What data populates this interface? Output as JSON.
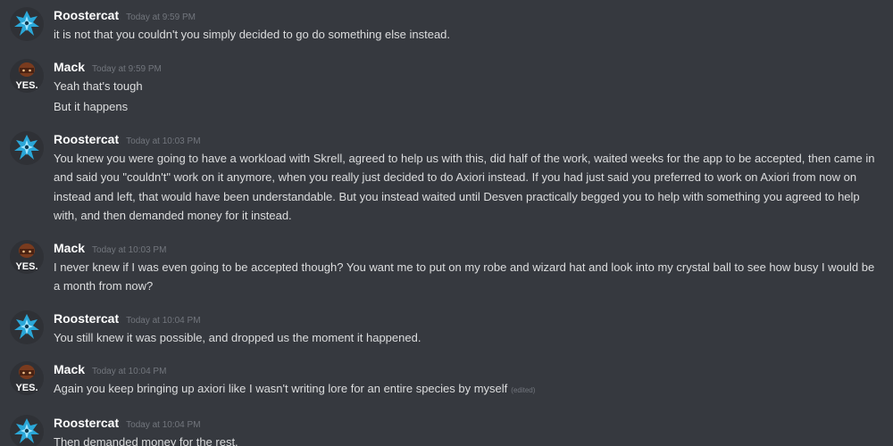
{
  "colors": {
    "background": "#36393f",
    "username": "#ffffff",
    "message_text": "#dcddde",
    "timestamp": "#72767d"
  },
  "avatars": {
    "roostercat": {
      "icon": "roostercat-avatar-icon",
      "color": "#2aa7d8"
    },
    "mack": {
      "icon": "mack-avatar-icon",
      "color": "#7a3b1e",
      "text": "YES."
    }
  },
  "groups": [
    {
      "username": "Roostercat",
      "timestamp": "Today at 9:59 PM",
      "messages": [
        "it is not that you couldn't you simply decided to go do something else instead."
      ]
    },
    {
      "username": "Mack",
      "timestamp": "Today at 9:59 PM",
      "messages": [
        "Yeah that's tough",
        "But it happens"
      ]
    },
    {
      "username": "Roostercat",
      "timestamp": "Today at 10:03 PM",
      "messages": [
        "You knew you were going to have a workload with Skrell, agreed to help us with this, did half of the work, waited weeks for the app to be accepted, then came in and said you \"couldn't\" work on it anymore, when you really just decided to do Axiori instead. If you had just said you preferred to work on Axiori from now on instead and left, that would have been understandable. But you instead waited until Desven practically begged you to help with something you agreed to help with, and then demanded money for it instead."
      ]
    },
    {
      "username": "Mack",
      "timestamp": "Today at 10:03 PM",
      "messages": [
        "I never knew if I was even going to be accepted though? You want me to put on my robe and wizard hat and look into my crystal ball to see how busy I would be a month from now?"
      ]
    },
    {
      "username": "Roostercat",
      "timestamp": "Today at 10:04 PM",
      "messages": [
        "You still knew it was possible, and dropped us the moment it happened."
      ]
    },
    {
      "username": "Mack",
      "timestamp": "Today at 10:04 PM",
      "messages": [
        "Again you keep bringing up axiori like I wasn't writing lore for an entire species by myself"
      ],
      "edited_label": "(edited)"
    },
    {
      "username": "Roostercat",
      "timestamp": "Today at 10:04 PM",
      "messages": [
        "Then demanded money for the rest."
      ]
    }
  ]
}
